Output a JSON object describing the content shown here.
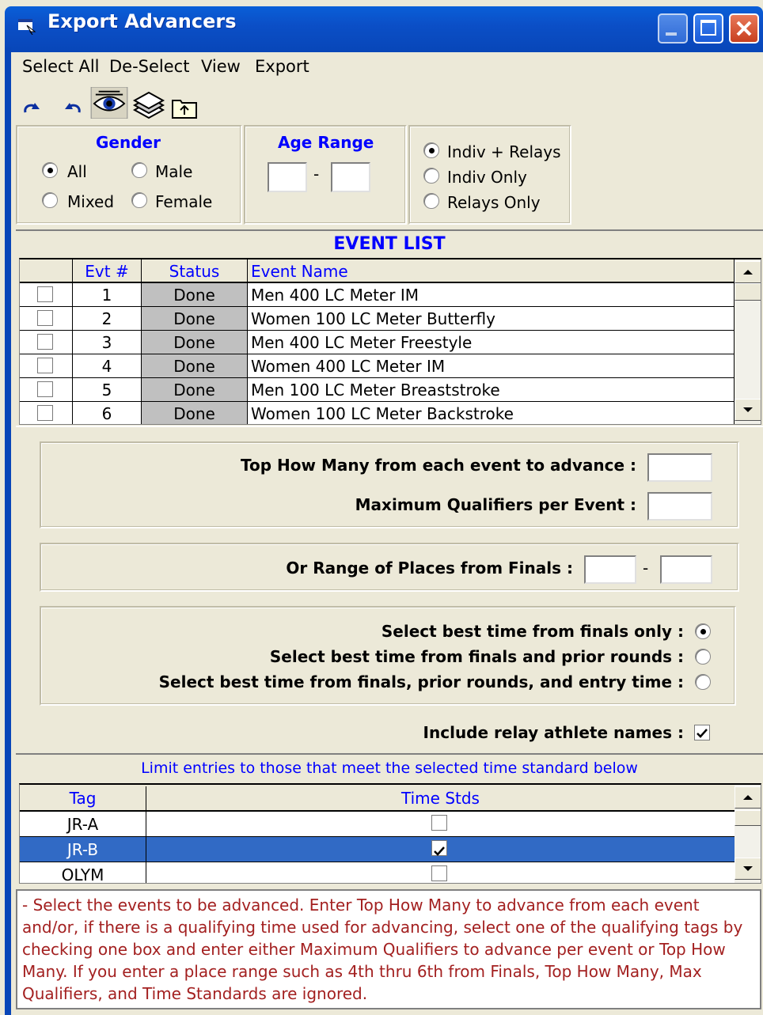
{
  "window": {
    "title": "Export Advancers"
  },
  "menu": [
    "Select All",
    "De-Select",
    "View",
    "Export"
  ],
  "toolbar": {
    "icons": [
      "redo-icon",
      "undo-icon",
      "eye-icon",
      "layers-icon",
      "folder-up-icon"
    ]
  },
  "gender": {
    "heading": "Gender",
    "options": [
      {
        "label": "All",
        "selected": true
      },
      {
        "label": "Male",
        "selected": false
      },
      {
        "label": "Mixed",
        "selected": false
      },
      {
        "label": "Female",
        "selected": false
      }
    ]
  },
  "age_range": {
    "heading": "Age Range",
    "from": "",
    "to": "",
    "separator": "-"
  },
  "event_type": {
    "options": [
      {
        "label": "Indiv + Relays",
        "selected": true
      },
      {
        "label": "Indiv Only",
        "selected": false
      },
      {
        "label": "Relays Only",
        "selected": false
      }
    ]
  },
  "event_list": {
    "heading": "EVENT LIST",
    "columns": [
      "",
      "Evt #",
      "Status",
      "Event Name"
    ],
    "rows": [
      {
        "checked": false,
        "evt": "1",
        "status": "Done",
        "name": "Men 400 LC Meter IM"
      },
      {
        "checked": false,
        "evt": "2",
        "status": "Done",
        "name": "Women 100 LC Meter Butterfly"
      },
      {
        "checked": false,
        "evt": "3",
        "status": "Done",
        "name": "Men 400 LC Meter Freestyle"
      },
      {
        "checked": false,
        "evt": "4",
        "status": "Done",
        "name": "Women 400 LC Meter IM"
      },
      {
        "checked": false,
        "evt": "5",
        "status": "Done",
        "name": "Men 100 LC Meter Breaststroke"
      },
      {
        "checked": false,
        "evt": "6",
        "status": "Done",
        "name": "Women 100 LC Meter Backstroke"
      }
    ]
  },
  "advance": {
    "top_how_many_label": "Top How Many from each event to advance :",
    "top_how_many": "",
    "max_qualifiers_label": "Maximum Qualifiers per Event :",
    "max_qualifiers": "",
    "range_label": "Or Range of Places from Finals :",
    "range_from": "",
    "range_to": "",
    "range_sep": "-"
  },
  "best_time": {
    "options": [
      {
        "label": "Select best time from finals only :",
        "selected": true
      },
      {
        "label": "Select best time from finals and prior rounds :",
        "selected": false
      },
      {
        "label": "Select best time from finals, prior rounds, and entry time :",
        "selected": false
      }
    ]
  },
  "relay_names": {
    "label": "Include relay athlete names :",
    "checked": true
  },
  "time_standards": {
    "heading": "Limit entries to those that meet the selected time standard below",
    "columns": [
      "Tag",
      "Time Stds"
    ],
    "rows": [
      {
        "tag": "JR-A",
        "checked": false,
        "selected": false
      },
      {
        "tag": "JR-B",
        "checked": true,
        "selected": true
      },
      {
        "tag": "OLYM",
        "checked": false,
        "selected": false
      }
    ]
  },
  "help_text": " - Select the events to be advanced.  Enter Top How Many to advance from each event and/or, if there is a qualifying time used for advancing, select one of the qualifying tags by checking one box and enter either Maximum Qualifiers to advance per event or Top How Many.  If you enter a place range such as 4th thru 6th from Finals, Top How Many, Max Qualifiers, and Time Standards are ignored.",
  "colors": {
    "titlebar": "#0846b8",
    "accent_blue": "#0000ff",
    "selection": "#316ac5",
    "help_text": "#a32020",
    "status_cell": "#c0c0c0"
  }
}
